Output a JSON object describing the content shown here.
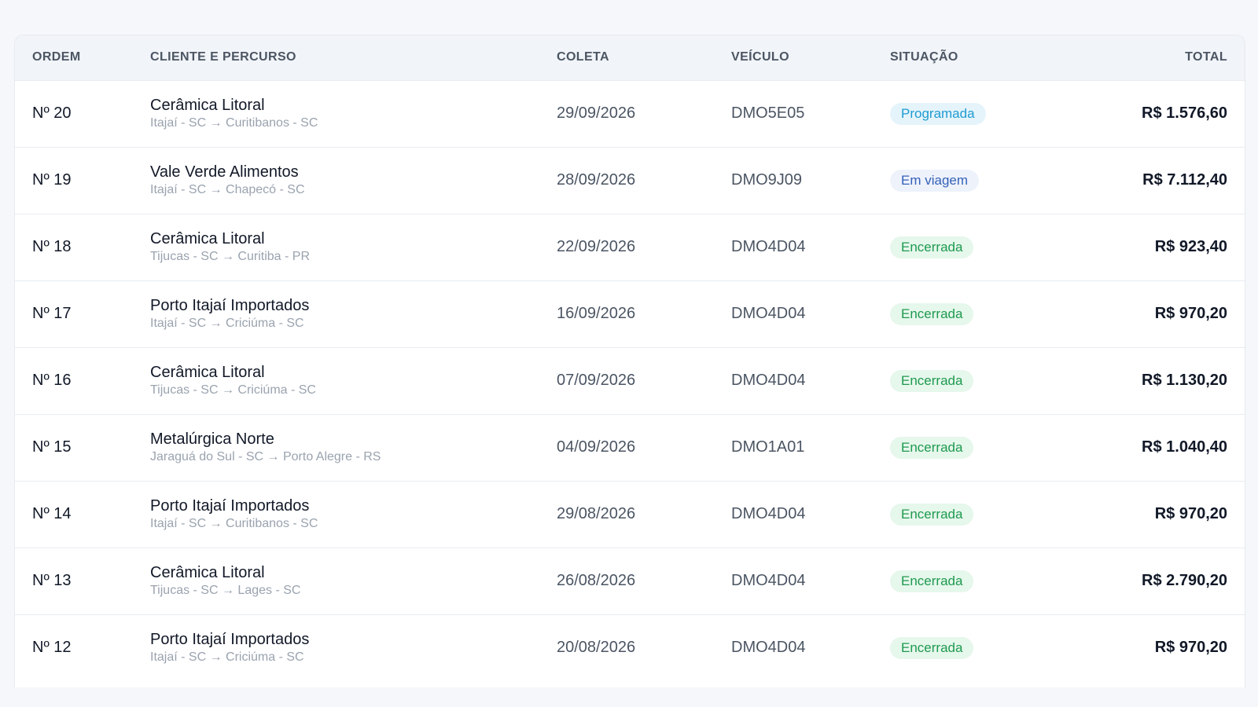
{
  "columns": {
    "ordem": "ORDEM",
    "cliente": "CLIENTE E PERCURSO",
    "coleta": "COLETA",
    "veiculo": "VEÍCULO",
    "situacao": "SITUAÇÃO",
    "total": "TOTAL"
  },
  "status_colors": {
    "programada": "#1f9bd1",
    "em_viagem": "#3461b8",
    "encerrada": "#1e9a4f"
  },
  "rows": [
    {
      "ordem": "Nº 20",
      "cliente": "Cerâmica Litoral",
      "percurso": "Itajaí - SC → Curitibanos - SC",
      "coleta": "29/09/2026",
      "veiculo": "DMO5E05",
      "situacao": "Programada",
      "status": "programada",
      "total": "R$ 1.576,60"
    },
    {
      "ordem": "Nº 19",
      "cliente": "Vale Verde Alimentos",
      "percurso": "Itajaí - SC → Chapecó - SC",
      "coleta": "28/09/2026",
      "veiculo": "DMO9J09",
      "situacao": "Em viagem",
      "status": "emviagem",
      "total": "R$ 7.112,40"
    },
    {
      "ordem": "Nº 18",
      "cliente": "Cerâmica Litoral",
      "percurso": "Tijucas - SC → Curitiba - PR",
      "coleta": "22/09/2026",
      "veiculo": "DMO4D04",
      "situacao": "Encerrada",
      "status": "encerrada",
      "total": "R$ 923,40"
    },
    {
      "ordem": "Nº 17",
      "cliente": "Porto Itajaí Importados",
      "percurso": "Itajaí - SC → Criciúma - SC",
      "coleta": "16/09/2026",
      "veiculo": "DMO4D04",
      "situacao": "Encerrada",
      "status": "encerrada",
      "total": "R$ 970,20"
    },
    {
      "ordem": "Nº 16",
      "cliente": "Cerâmica Litoral",
      "percurso": "Tijucas - SC → Criciúma - SC",
      "coleta": "07/09/2026",
      "veiculo": "DMO4D04",
      "situacao": "Encerrada",
      "status": "encerrada",
      "total": "R$ 1.130,20"
    },
    {
      "ordem": "Nº 15",
      "cliente": "Metalúrgica Norte",
      "percurso": "Jaraguá do Sul - SC → Porto Alegre - RS",
      "coleta": "04/09/2026",
      "veiculo": "DMO1A01",
      "situacao": "Encerrada",
      "status": "encerrada",
      "total": "R$ 1.040,40"
    },
    {
      "ordem": "Nº 14",
      "cliente": "Porto Itajaí Importados",
      "percurso": "Itajaí - SC → Curitibanos - SC",
      "coleta": "29/08/2026",
      "veiculo": "DMO4D04",
      "situacao": "Encerrada",
      "status": "encerrada",
      "total": "R$ 970,20"
    },
    {
      "ordem": "Nº 13",
      "cliente": "Cerâmica Litoral",
      "percurso": "Tijucas - SC → Lages - SC",
      "coleta": "26/08/2026",
      "veiculo": "DMO4D04",
      "situacao": "Encerrada",
      "status": "encerrada",
      "total": "R$ 2.790,20"
    },
    {
      "ordem": "Nº 12",
      "cliente": "Porto Itajaí Importados",
      "percurso": "Itajaí - SC → Criciúma - SC",
      "coleta": "20/08/2026",
      "veiculo": "DMO4D04",
      "situacao": "Encerrada",
      "status": "encerrada",
      "total": "R$ 970,20"
    }
  ]
}
